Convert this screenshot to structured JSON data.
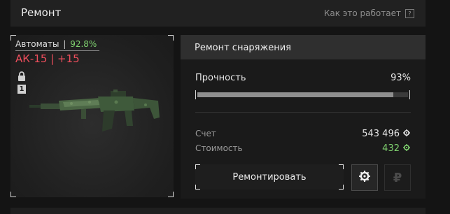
{
  "header": {
    "title": "Ремонт",
    "help_link": "Как это работает",
    "help_icon": "?"
  },
  "item": {
    "category": "Автоматы",
    "separator": "|",
    "condition_percent": "92.8%",
    "name": "АК-15 | +15",
    "count": "1",
    "lock_icon": "lock-icon",
    "image_icon": "assault-rifle-icon"
  },
  "repair": {
    "title": "Ремонт снаряжения",
    "durability_label": "Прочность",
    "durability_value": "93%",
    "durability_fraction": 0.93,
    "balance_label": "Счет",
    "balance_value": "543 496",
    "cost_label": "Стоимость",
    "cost_value": "432",
    "repair_button_label": "Ремонтировать",
    "currency_crown_icon": "crown-currency-icon",
    "currency_ruble_symbol": "₽"
  },
  "colors": {
    "accent_green": "#7fd16f",
    "item_red": "#ee4e5c"
  }
}
